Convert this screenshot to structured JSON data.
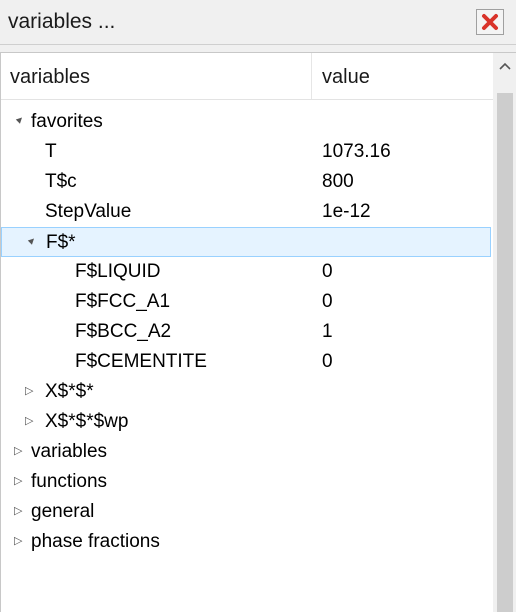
{
  "window": {
    "title": "variables ..."
  },
  "columns": {
    "name": "variables",
    "value": "value"
  },
  "rows": [
    {
      "name": "favorites",
      "value": "",
      "toggle": "▲",
      "expanded": true,
      "depth": 0,
      "selected": false
    },
    {
      "name": "T",
      "value": "1073.16",
      "toggle": "",
      "depth": 1,
      "selected": false
    },
    {
      "name": "T$c",
      "value": "800",
      "toggle": "",
      "depth": 1,
      "selected": false
    },
    {
      "name": "StepValue",
      "value": "1e-12",
      "toggle": "",
      "depth": 1,
      "selected": false
    },
    {
      "name": "F$*",
      "value": "",
      "toggle": "▲",
      "expanded": true,
      "depth": 1,
      "selected": true
    },
    {
      "name": "F$LIQUID",
      "value": "0",
      "toggle": "",
      "depth": 2,
      "selected": false
    },
    {
      "name": "F$FCC_A1",
      "value": "0",
      "toggle": "",
      "depth": 2,
      "selected": false
    },
    {
      "name": "F$BCC_A2",
      "value": "1",
      "toggle": "",
      "depth": 2,
      "selected": false
    },
    {
      "name": "F$CEMENTITE",
      "value": "0",
      "toggle": "",
      "depth": 2,
      "selected": false
    },
    {
      "name": "X$*$*",
      "value": "",
      "toggle": "▷",
      "expanded": false,
      "depth": 1,
      "selected": false
    },
    {
      "name": "X$*$*$wp",
      "value": "",
      "toggle": "▷",
      "expanded": false,
      "depth": 1,
      "selected": false
    },
    {
      "name": "variables",
      "value": "",
      "toggle": "▷",
      "expanded": false,
      "depth": 0,
      "selected": false
    },
    {
      "name": "functions",
      "value": "",
      "toggle": "▷",
      "expanded": false,
      "depth": 0,
      "selected": false
    },
    {
      "name": "general",
      "value": "",
      "toggle": "▷",
      "expanded": false,
      "depth": 0,
      "selected": false
    },
    {
      "name": "phase fractions",
      "value": "",
      "toggle": "▷",
      "expanded": false,
      "depth": 0,
      "selected": false
    }
  ],
  "icons": {
    "close": "close-icon",
    "scroll_up": "chevron-up-icon"
  },
  "colors": {
    "close": "#d9332a",
    "selection_bg": "#e5f3ff",
    "selection_border": "#99d1ff"
  }
}
